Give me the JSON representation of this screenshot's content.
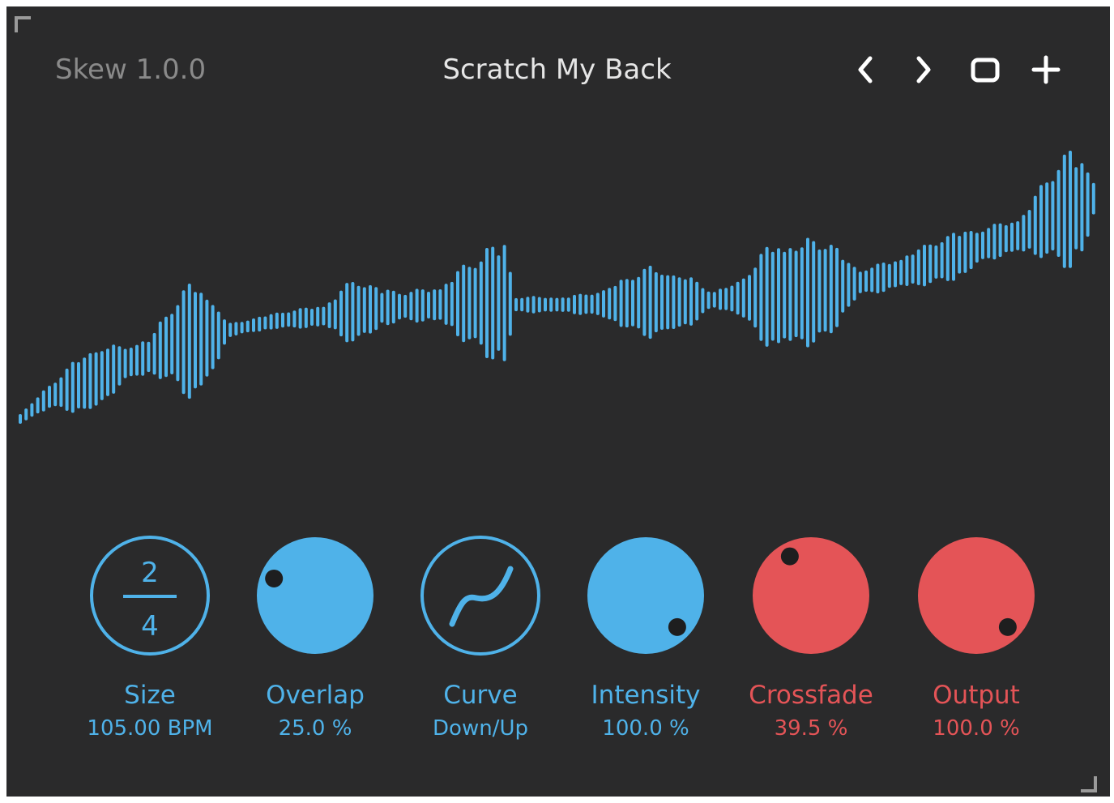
{
  "header": {
    "app_title": "Skew 1.0.0",
    "preset_name": "Scratch My Back",
    "buttons": [
      {
        "name": "prev-preset-button",
        "icon": "chevron-left-icon"
      },
      {
        "name": "next-preset-button",
        "icon": "chevron-right-icon"
      },
      {
        "name": "window-button",
        "icon": "rounded-square-icon"
      },
      {
        "name": "add-preset-button",
        "icon": "plus-icon"
      }
    ]
  },
  "colors": {
    "background": "#2a2a2b",
    "accent_blue": "#4fb2e9",
    "accent_red": "#e45457",
    "title_gray": "#8a8a8a",
    "text_light": "#e6e6e6"
  },
  "waveform": {
    "color": "#4fb2e9"
  },
  "knobs": [
    {
      "id": "size",
      "label": "Size",
      "value": "105.00 BPM",
      "style": "fraction",
      "numerator": "2",
      "denominator": "4",
      "color": "blue"
    },
    {
      "id": "overlap",
      "label": "Overlap",
      "value": "25.0 %",
      "style": "filled",
      "color": "blue",
      "level": 0.25
    },
    {
      "id": "curve",
      "label": "Curve",
      "value": "Down/Up",
      "style": "curve",
      "color": "blue"
    },
    {
      "id": "intensity",
      "label": "Intensity",
      "value": "100.0 %",
      "style": "filled",
      "color": "blue",
      "level": 1.0
    },
    {
      "id": "crossfade",
      "label": "Crossfade",
      "value": "39.5 %",
      "style": "filled",
      "color": "red",
      "level": 0.395
    },
    {
      "id": "output",
      "label": "Output",
      "value": "100.0 %",
      "style": "filled",
      "color": "red",
      "level": 1.0
    }
  ]
}
